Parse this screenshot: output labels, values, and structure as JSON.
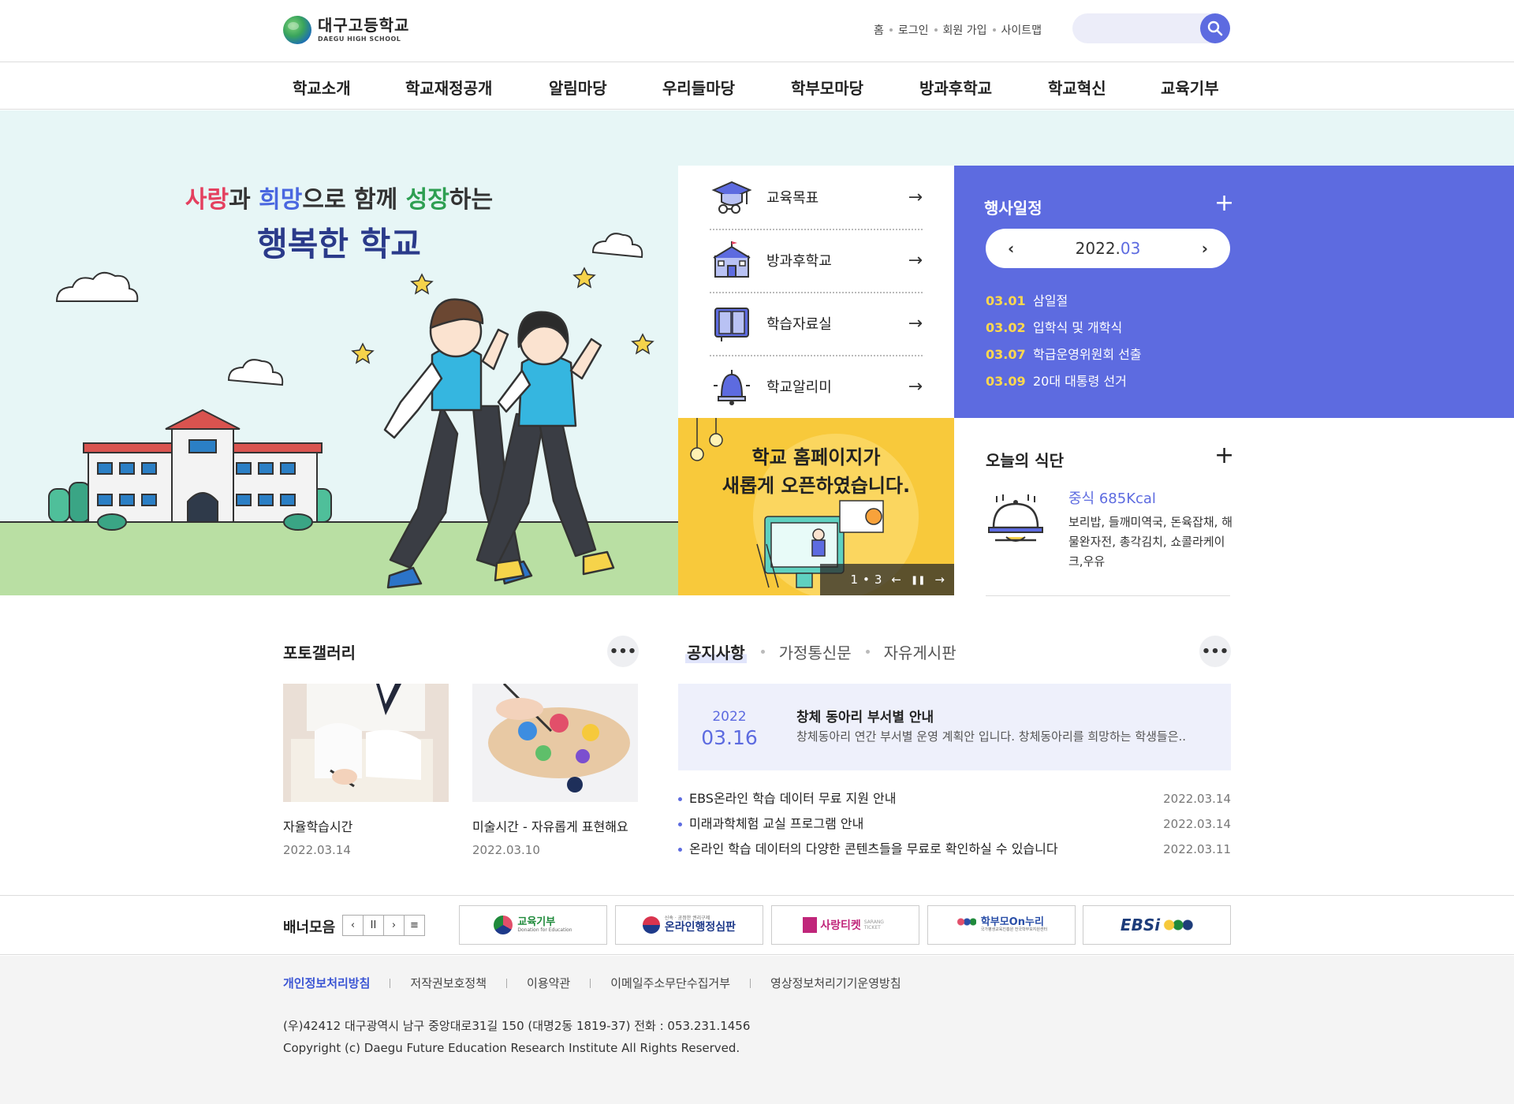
{
  "site": {
    "logo_kr": "대구고등학교",
    "logo_en": "DAEGU HIGH SCHOOL"
  },
  "util": {
    "home": "홈",
    "login": "로그인",
    "join": "회원 가입",
    "sitemap": "사이트맵"
  },
  "search": {
    "value": "",
    "icon": "search-icon"
  },
  "gnb": [
    {
      "label": "학교소개"
    },
    {
      "label": "학교재정공개"
    },
    {
      "label": "알림마당"
    },
    {
      "label": "우리들마당"
    },
    {
      "label": "학부모마당"
    },
    {
      "label": "방과후학교"
    },
    {
      "label": "학교혁신"
    },
    {
      "label": "교육기부"
    }
  ],
  "hero": {
    "line1_w1": "사랑",
    "line1_t1": "과 ",
    "line1_w2": "희망",
    "line1_t2": "으로 함께 ",
    "line1_w3": "성장",
    "line1_t3": "하는",
    "line2": "행복한 학교"
  },
  "quick": [
    {
      "label": "교육목표",
      "icon": "graduation-cap-icon",
      "arrow": "→"
    },
    {
      "label": "방과후학교",
      "icon": "school-building-icon",
      "arrow": "→"
    },
    {
      "label": "학습자료실",
      "icon": "book-icon",
      "arrow": "→"
    },
    {
      "label": "학교알리미",
      "icon": "bell-icon",
      "arrow": "→"
    }
  ],
  "promo": {
    "line1": "학교 홈페이지가",
    "line2": "새롭게 오픈하였습니다.",
    "current": "1",
    "total": "3",
    "prev": "←",
    "pause": "❚❚",
    "next": "→"
  },
  "schedule": {
    "title": "행사일정",
    "plus": "+",
    "year": "2022.",
    "month": "03",
    "prev": "‹",
    "next": "›",
    "items": [
      {
        "date": "03.01",
        "title": "삼일절"
      },
      {
        "date": "03.02",
        "title": "입학식 및 개학식"
      },
      {
        "date": "03.07",
        "title": "학급운영위원회 선출"
      },
      {
        "date": "03.09",
        "title": "20대 대통령 선거"
      }
    ]
  },
  "meal": {
    "title": "오늘의 식단",
    "plus": "+",
    "type": "중식 685Kcal",
    "menu": "보리밥, 들깨미역국, 돈육잡채, 해물완자전, 총각김치, 쇼콜라케이크,우유"
  },
  "gallery": {
    "title": "포토갤러리",
    "more": "•••",
    "items": [
      {
        "caption": "자율학습시간",
        "date": "2022.03.14"
      },
      {
        "caption": "미술시간 - 자유롭게 표현해요",
        "date": "2022.03.10"
      }
    ]
  },
  "notice": {
    "tabs": [
      "공지사항",
      "가정통신문",
      "자유게시판"
    ],
    "more": "•••",
    "top": {
      "year": "2022",
      "date": "03.16",
      "title": "창체 동아리 부서별 안내",
      "desc": "창체동아리 연간 부서별 운영 계획안 입니다. 창체동아리를 희망하는 학생들은.."
    },
    "items": [
      {
        "title": "EBS온라인 학습 데이터 무료 지원 안내",
        "date": "2022.03.14"
      },
      {
        "title": "미래과학체험 교실 프로그램 안내",
        "date": "2022.03.14"
      },
      {
        "title": "온라인 학습 데이터의 다양한 콘텐츠들을 무료로 확인하실 수 있습니다",
        "date": "2022.03.11"
      }
    ]
  },
  "banner": {
    "title": "배너모음",
    "ctrl": [
      "‹",
      "II",
      "›",
      "≡"
    ],
    "items": [
      {
        "label": "교육기부",
        "sub": "Donation for Education",
        "color": "#1f8a3b"
      },
      {
        "label": "온라인행정심판",
        "sub": "신속 · 공정한 권리구제",
        "color": "#1e3a8a"
      },
      {
        "label": "사랑티켓",
        "sub": "SARANG TICKET",
        "color": "#c0267a"
      },
      {
        "label": "학부모On누리",
        "sub": "국가평생교육진흥원 전국학부모지원센터",
        "color": "#2a4fa8"
      },
      {
        "label": "EBSi",
        "sub": "",
        "color": "#1d3c7a"
      }
    ]
  },
  "footer": {
    "links": [
      {
        "label": "개인정보처리방침",
        "on": true
      },
      {
        "label": "저작권보호정책"
      },
      {
        "label": "이용약관"
      },
      {
        "label": "이메일주소무단수집거부"
      },
      {
        "label": "영상정보처리기기운영방침"
      }
    ],
    "address": "(우)42412 대구광역시 남구 중앙대로31길 150 (대명2동 1819-37)  전화 : 053.231.1456",
    "copyright": "Copyright (c) Daegu Future Education Research Institute All Rights Reserved."
  },
  "colors": {
    "accent": "#5d6be0",
    "hero_bg": "#e7f6f6",
    "promo_bg": "#f8c93b",
    "schedule_date": "#ffd84d"
  }
}
